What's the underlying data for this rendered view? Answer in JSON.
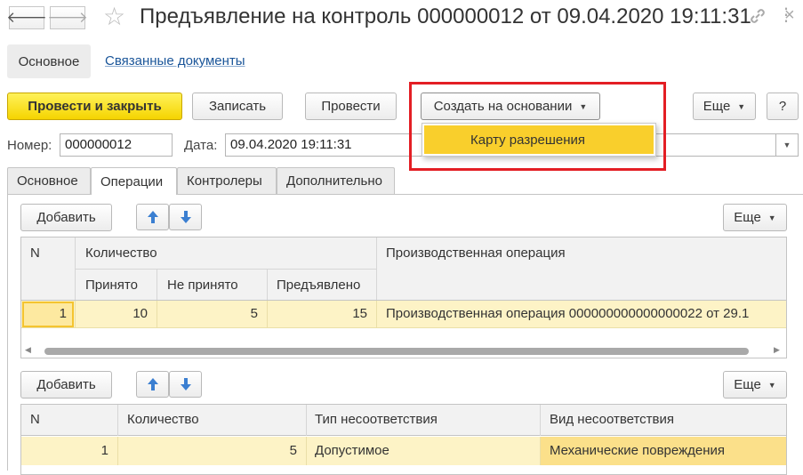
{
  "window": {
    "title": "Предъявление на контроль 000000012 от 09.04.2020 19:11:31",
    "back_icon": "arrow-left-icon",
    "forward_icon": "arrow-right-icon",
    "star_icon": "star-icon",
    "link_icon": "link-icon",
    "more_icon": "kebab-icon",
    "close_icon": "close-icon"
  },
  "nav": {
    "main": "Основное",
    "related": "Связанные документы"
  },
  "toolbar": {
    "post_close": "Провести и закрыть",
    "save": "Записать",
    "post": "Провести",
    "create_based": "Создать на основании",
    "more": "Еще",
    "help": "?"
  },
  "dropdown": {
    "item": "Карту разрешения"
  },
  "header": {
    "number_label": "Номер:",
    "number_value": "000000012",
    "date_label": "Дата:",
    "date_value": "09.04.2020 19:11:31"
  },
  "tabs": [
    "Основное",
    "Операции",
    "Контролеры",
    "Дополнительно"
  ],
  "table1": {
    "add": "Добавить",
    "more": "Еще",
    "col_n": "N",
    "col_qty": "Количество",
    "col_accepted": "Принято",
    "col_not_accepted": "Не принято",
    "col_presented": "Предъявлено",
    "col_operation": "Производственная операция",
    "row": {
      "n": "1",
      "accepted": "10",
      "not_accepted": "5",
      "presented": "15",
      "operation": "Производственная операция 000000000000000022 от 29.1"
    }
  },
  "table2": {
    "add": "Добавить",
    "more": "Еще",
    "col_n": "N",
    "col_qty": "Количество",
    "col_type": "Тип несоответствия",
    "col_kind": "Вид несоответствия",
    "row": {
      "n": "1",
      "qty": "5",
      "type": "Допустимое",
      "kind": "Механические повреждения"
    }
  },
  "colors": {
    "primary": "#f5d400",
    "highlight_border": "#e31e24",
    "selected_row": "#fdf3c6",
    "dropdown_item": "#f9cf2c"
  }
}
